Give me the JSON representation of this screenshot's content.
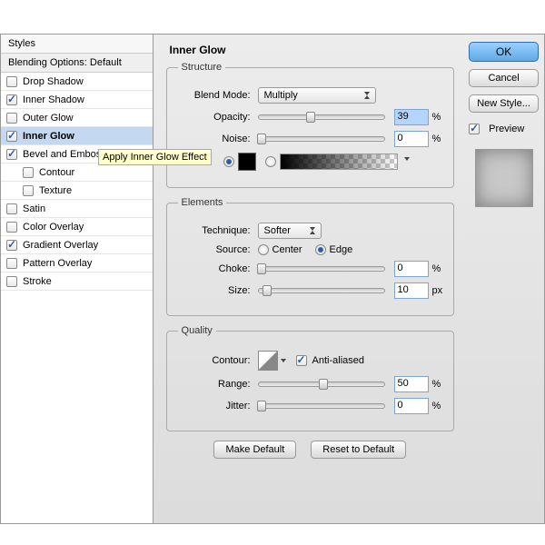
{
  "sidebar": {
    "header": "Styles",
    "subheader": "Blending Options: Default",
    "items": [
      {
        "label": "Drop Shadow",
        "checked": false
      },
      {
        "label": "Inner Shadow",
        "checked": true
      },
      {
        "label": "Outer Glow",
        "checked": false
      },
      {
        "label": "Inner Glow",
        "checked": true,
        "selected": true
      },
      {
        "label": "Bevel and Emboss",
        "checked": true
      },
      {
        "label": "Contour",
        "checked": false,
        "indent": true
      },
      {
        "label": "Texture",
        "checked": false,
        "indent": true
      },
      {
        "label": "Satin",
        "checked": false
      },
      {
        "label": "Color Overlay",
        "checked": false
      },
      {
        "label": "Gradient Overlay",
        "checked": true
      },
      {
        "label": "Pattern Overlay",
        "checked": false
      },
      {
        "label": "Stroke",
        "checked": false
      }
    ]
  },
  "tooltip": "Apply Inner Glow Effect",
  "panel": {
    "title": "Inner Glow",
    "structure": {
      "legend": "Structure",
      "blend_mode_label": "Blend Mode:",
      "blend_mode": "Multiply",
      "opacity_label": "Opacity:",
      "opacity": "39",
      "opacity_unit": "%",
      "noise_label": "Noise:",
      "noise": "0",
      "noise_unit": "%"
    },
    "elements": {
      "legend": "Elements",
      "technique_label": "Technique:",
      "technique": "Softer",
      "source_label": "Source:",
      "source_center": "Center",
      "source_edge": "Edge",
      "choke_label": "Choke:",
      "choke": "0",
      "choke_unit": "%",
      "size_label": "Size:",
      "size": "10",
      "size_unit": "px"
    },
    "quality": {
      "legend": "Quality",
      "contour_label": "Contour:",
      "anti_label": "Anti-aliased",
      "range_label": "Range:",
      "range": "50",
      "range_unit": "%",
      "jitter_label": "Jitter:",
      "jitter": "0",
      "jitter_unit": "%"
    },
    "buttons": {
      "make_default": "Make Default",
      "reset": "Reset to Default"
    }
  },
  "right": {
    "ok": "OK",
    "cancel": "Cancel",
    "new_style": "New Style...",
    "preview_label": "Preview"
  }
}
